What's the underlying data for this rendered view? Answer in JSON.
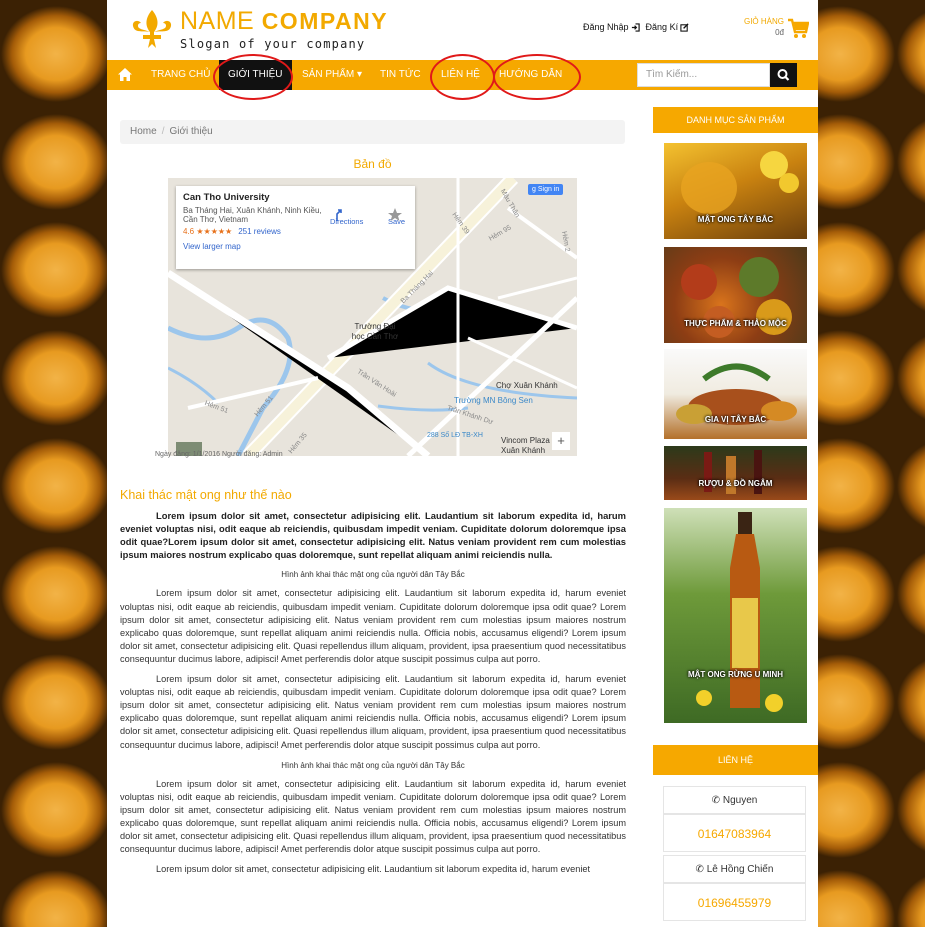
{
  "header": {
    "brand_light": "NAME",
    "brand_bold": "COMPANY",
    "slogan": "Slogan of your company",
    "login": "Đăng Nhập",
    "register": "Đăng Kí",
    "cart_title": "GIỎ HÀNG",
    "cart_total": "0đ"
  },
  "nav": {
    "items": [
      "TRANG CHỦ",
      "GIỚI THIỆU",
      "SẢN PHẨM ▾",
      "TIN TỨC",
      "LIÊN HỆ",
      "HƯỚNG DẪN"
    ],
    "active": "GIỚI THIỆU",
    "search_placeholder": "Tìm Kiếm..."
  },
  "breadcrumb": {
    "home": "Home",
    "current": "Giới thiệu"
  },
  "map": {
    "title": "Bản đồ",
    "place": "Can Tho University",
    "address": "Ba Tháng Hai, Xuân Khánh, Ninh Kiều, Cần Thơ, Vietnam",
    "rating": "4.6 ★★★★★",
    "reviews": "251 reviews",
    "larger": "View larger map",
    "directions": "Directions",
    "save": "Save",
    "signin": "Sign in",
    "labels": [
      "Trường Đại học Cần Thơ",
      "Ba Tháng Hai",
      "Trần Văn Hoài",
      "Chợ Xuân Khánh",
      "Trường MN Bông Sen",
      "Trần Khánh Dư",
      "288 Số LĐ TB-XH",
      "Vincom Plaza Xuân Khánh",
      "Hẻm 95",
      "Mậu Thân",
      "Hẻm 39",
      "Hẻm 51",
      "Hẻm 2",
      "Hẻm 51",
      "Hẻm 35"
    ],
    "footer": "Ngày đăng: 1/1/2016 Người đăng: Admin"
  },
  "article": {
    "title": "Khai thác mật ong như thế nào",
    "lead": "Lorem ipsum dolor sit amet, consectetur adipisicing elit. Laudantium sit laborum expedita id, harum eveniet voluptas nisi, odit eaque ab reiciendis, quibusdam impedit veniam. Cupiditate dolorum doloremque ipsa odit quae?Lorem ipsum dolor sit amet, consectetur adipisicing elit. Natus veniam provident rem cum molestias ipsum maiores nostrum explicabo quas doloremque, sunt repellat aliquam animi reiciendis nulla.",
    "caption": "Hình ảnh khai thác mật ong của người dân Tây Bắc",
    "para": "Lorem ipsum dolor sit amet, consectetur adipisicing elit. Laudantium sit laborum expedita id, harum eveniet voluptas nisi, odit eaque ab reiciendis, quibusdam impedit veniam. Cupiditate dolorum doloremque ipsa odit quae? Lorem ipsum dolor sit amet, consectetur adipisicing elit. Natus veniam provident rem cum molestias ipsum maiores nostrum explicabo quas doloremque, sunt repellat aliquam animi reiciendis nulla. Officia nobis, accusamus eligendi? Lorem ipsum dolor sit amet, consectetur adipisicing elit. Quasi repellendus illum aliquam, provident, ipsa praesentium quod necessitatibus consequuntur ducimus labore, adipisci! Amet perferendis dolor atque suscipit possimus culpa aut porro.",
    "para_last": "Lorem ipsum dolor sit amet, consectetur adipisicing elit. Laudantium sit laborum expedita id, harum eveniet"
  },
  "sidebar": {
    "categories_title": "DANH MỤC SẢN PHẨM",
    "categories": [
      "MẬT ONG TÂY BẮC",
      "THỰC PHẨM & THẢO MỘC",
      "GIA VỊ TÂY BẮC",
      "RƯỢU & ĐỒ NGÂM",
      "MẬT ONG RỪNG U MINH"
    ],
    "contact_title": "LIÊN HỆ",
    "contacts": [
      {
        "name": "Nguyen",
        "phone": "01647083964"
      },
      {
        "name": "Lê Hồng Chiến",
        "phone": "01696455979"
      }
    ]
  },
  "colors": {
    "accent": "#f6a800",
    "brand": "#f2a900",
    "active_nav": "#111111",
    "annotation": "#e01919"
  }
}
